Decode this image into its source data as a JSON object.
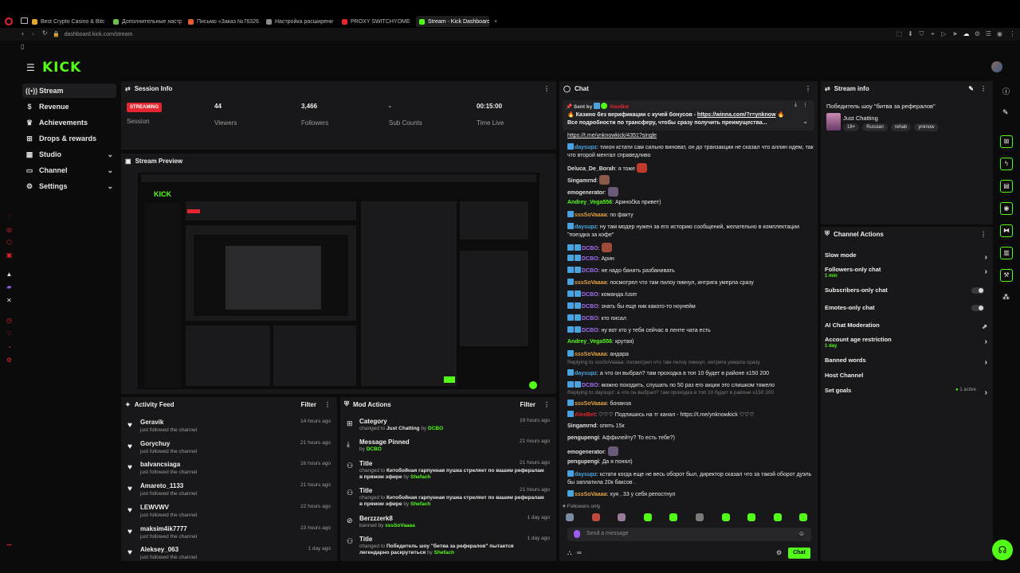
{
  "browser": {
    "tabs": [
      {
        "label": "Best Crypto Casino & Bitc",
        "color": "#e5a52f"
      },
      {
        "label": "Дополнительные настро",
        "color": "#6cc04a"
      },
      {
        "label": "Письмо «Заказ №76326",
        "color": "#e8612c"
      },
      {
        "label": "Настройка расширени",
        "color": "#8a8a8a"
      },
      {
        "label": "PROXY SWITCHYOMEGA",
        "color": "#e5252f"
      },
      {
        "label": "Stream - Kick Dashboard",
        "color": "#53fc18"
      }
    ],
    "url": "dashboard.kick.com/stream"
  },
  "brand": {
    "logo": "KICK",
    "accent": "#53fc18",
    "live_red": "#e5252f"
  },
  "nav": {
    "items": [
      {
        "label": "Stream",
        "icon": "broadcast-icon",
        "active": true
      },
      {
        "label": "Revenue",
        "icon": "dollar-icon"
      },
      {
        "label": "Achievements",
        "icon": "trophy-icon"
      },
      {
        "label": "Drops & rewards",
        "icon": "gift-icon"
      },
      {
        "label": "Studio",
        "icon": "studio-icon",
        "chevron": true
      },
      {
        "label": "Channel",
        "icon": "channel-icon",
        "chevron": true
      },
      {
        "label": "Settings",
        "icon": "gear-icon",
        "chevron": true
      }
    ]
  },
  "session": {
    "title": "Session Info",
    "status": "STREAMING",
    "status_label": "Session",
    "viewers": "44",
    "viewers_label": "Viewers",
    "followers": "3,466",
    "followers_label": "Followers",
    "subs": "-",
    "subs_label": "Sub Counts",
    "time": "00:15:00",
    "time_label": "Time Live"
  },
  "preview": {
    "title": "Stream Preview"
  },
  "activity": {
    "title": "Activity Feed",
    "filter": "Filter",
    "items": [
      {
        "name": "Geravik",
        "sub": "just followed the channel",
        "time": "14 hours ago"
      },
      {
        "name": "Gorychuy",
        "sub": "just followed the channel",
        "time": "21 hours ago"
      },
      {
        "name": "balvancsiaga",
        "sub": "just followed the channel",
        "time": "16 hours ago"
      },
      {
        "name": "Amareto_1133",
        "sub": "just followed the channel",
        "time": "21 hours ago"
      },
      {
        "name": "LEWVWV",
        "sub": "just followed the channel",
        "time": "22 hours ago"
      },
      {
        "name": "maksim4ik7777",
        "sub": "just followed the channel",
        "time": "23 hours ago"
      },
      {
        "name": "Aleksey_063",
        "sub": "just followed the channel",
        "time": "1 day ago"
      }
    ]
  },
  "mod": {
    "title": "Mod Actions",
    "filter": "Filter",
    "items": [
      {
        "name": "Category",
        "pre": "changed to",
        "a": "Just Chatting",
        "mid": "by",
        "b": "DCBO",
        "time": "19 hours ago",
        "icon": "category-icon"
      },
      {
        "name": "Message Pinned",
        "pre": "by",
        "a": "",
        "mid": "",
        "b": "DCBO",
        "time": "21 hours ago",
        "icon": "pin-icon"
      },
      {
        "name": "Title",
        "pre": "changed to",
        "a": "Китобойная гарпунная пушка стреляет по вашим рефералам в прямом эфире",
        "mid": "by",
        "b": "Shefach",
        "time": "21 hours ago",
        "icon": "people-icon"
      },
      {
        "name": "Title",
        "pre": "changed to",
        "a": "Китобойная гарпунная пушка стреляет по вашим рефералам в прямом эфире",
        "mid": "by",
        "b": "Shefach",
        "time": "21 hours ago",
        "icon": "people-icon"
      },
      {
        "name": "Berzzzerk8",
        "pre": "banned by",
        "a": "",
        "mid": "",
        "b": "sssSoVaaaa",
        "time": "1 day ago",
        "icon": "ban-icon"
      },
      {
        "name": "Title",
        "pre": "changed to",
        "a": "Победитель шоу \"битва за рефералов\" пытается легендарно раскрутиться",
        "mid": "by",
        "b": "Shefach",
        "time": "1 day ago",
        "icon": "people-icon"
      }
    ]
  },
  "chat": {
    "title": "Chat",
    "pinned_sent_by": "Sent by",
    "pinned_user": "AlexBet",
    "pinned_text": "Казино без верификации с кучей бонусов - ",
    "pinned_link": "https://winna.com/?r=ynknow",
    "pinned_text2": "Все подробности по трансферу, чтобы сразу получить преимущества...",
    "messages": [
      {
        "u": "",
        "t": "https://t.me/ynknowkick/4351?single",
        "c": "#4aa3df",
        "b": 0
      },
      {
        "u": "daysupz",
        "t": "тихон кстати сам сильно виноват, он до транзакции не сказал что аллин идем, так что второй ментал справедливо",
        "c": "#4aa3df",
        "b": 1
      },
      {
        "u": "Deluca_De_Borah",
        "t": "я тоже",
        "c": "#e0e0e0",
        "b": 0
      },
      {
        "u": "Singamrnd",
        "t": "",
        "c": "#e0e0e0",
        "b": 0
      },
      {
        "u": "emogenerator",
        "t": "",
        "c": "#e0e0e0",
        "b": 0
      },
      {
        "u": "Andrey_Vega556",
        "t": "Аринočka привет)",
        "c": "#53fc18",
        "b": 0
      },
      {
        "u": "sssSoVaaaa",
        "t": "по факту",
        "c": "#e6a23c",
        "b": 1
      },
      {
        "u": "daysupz",
        "t": "ну там модер нужен за его историю сообщений, желательно в комплектации \"поездка за кофе\"",
        "c": "#4aa3df",
        "b": 1
      },
      {
        "u": "DCBO",
        "t": "",
        "c": "#a36cf0",
        "b": 2
      },
      {
        "u": "DCBO",
        "t": "Арин",
        "c": "#a36cf0",
        "b": 2
      },
      {
        "u": "DCBO",
        "t": "не надо банить разбанивать",
        "c": "#a36cf0",
        "b": 2
      },
      {
        "u": "sssSoVaaaa",
        "t": "посмотрел что там пилоу пикнул, интрига умерла сразу",
        "c": "#e6a23c",
        "b": 1
      },
      {
        "u": "DCBO",
        "t": "команда /user",
        "c": "#a36cf0",
        "b": 2
      },
      {
        "u": "DCBO",
        "t": "знать бы еще ник какого-то ноунейм",
        "c": "#a36cf0",
        "b": 2
      },
      {
        "u": "DCBO",
        "t": "кто писал",
        "c": "#a36cf0",
        "b": 2
      },
      {
        "u": "DCBO",
        "t": "ну вот кто у тебя сейчас в ленте чата есть",
        "c": "#a36cf0",
        "b": 2
      },
      {
        "u": "Andrey_Vega556",
        "t": "крутая)",
        "c": "#53fc18",
        "b": 0
      },
      {
        "u": "sssSoVaaaa",
        "t": "андара",
        "c": "#e6a23c",
        "b": 1
      },
      {
        "u": "daysupz",
        "t": "а что он выбрал? там проходка в топ 10 будет в районе х150 200",
        "c": "#4aa3df",
        "b": 1
      },
      {
        "u": "DCBO",
        "t": "можно походить, слушать по 50 раз его акции это слишком тяжело",
        "c": "#a36cf0",
        "b": 2
      },
      {
        "u": "sssSoVaaaa",
        "t": "бонанза",
        "c": "#e6a23c",
        "b": 1
      },
      {
        "u": "AlexBet",
        "t": "♡♡♡ Подпишись на тг канал - https://t.me/ynknowkick ♡♡♡",
        "c": "#e5252f",
        "b": 1
      },
      {
        "u": "Singamrnd",
        "t": "опять 15к",
        "c": "#e0e0e0",
        "b": 0
      },
      {
        "u": "pengupengi",
        "t": "Аффилейту? То есть тебе?)",
        "c": "#e0e0e0",
        "b": 0
      },
      {
        "u": "emogenerator",
        "t": "",
        "c": "#e0e0e0",
        "b": 0
      },
      {
        "u": "pengupengi",
        "t": "Да я понял)",
        "c": "#e0e0e0",
        "b": 0
      },
      {
        "u": "daysupz",
        "t": "кстати когда еще не весь оборот был, директор сказал что за такой оборот дуэль бы заплатила 20к баксов .",
        "c": "#4aa3df",
        "b": 1
      },
      {
        "u": "sssSoVaaaa",
        "t": "хуя , 33 у себя репостнул",
        "c": "#e6a23c",
        "b": 1
      }
    ],
    "reply1": "Replying to sssSoVaaaa: посмотрел что там пилоу пикнул, интрига умерла сразу",
    "reply2": "Replying to daysupz: а что он выбрал? там проходка в топ 10 будет в районе х150 200",
    "followers_only": "Followers only",
    "placeholder": "Send a message",
    "send": "Chat"
  },
  "streaminfo": {
    "title": "Stream info",
    "stream_title": "Победитель шоу \"битва за рефералов\"",
    "category": "Just Chatting",
    "tags": [
      "18+",
      "Russian",
      "rehab",
      "ynknow"
    ]
  },
  "actions": {
    "title": "Channel Actions",
    "slow": "Slow mode",
    "followers": "Followers-only chat",
    "followers_sub": "1 min",
    "subs": "Subscribers-only chat",
    "emotes": "Emotes-only chat",
    "ai": "AI Chat Moderation",
    "age": "Account age restriction",
    "age_sub": "1 day",
    "banned": "Banned words",
    "host": "Host Channel",
    "goals": "Set goals",
    "goals_sub": "1 active"
  }
}
